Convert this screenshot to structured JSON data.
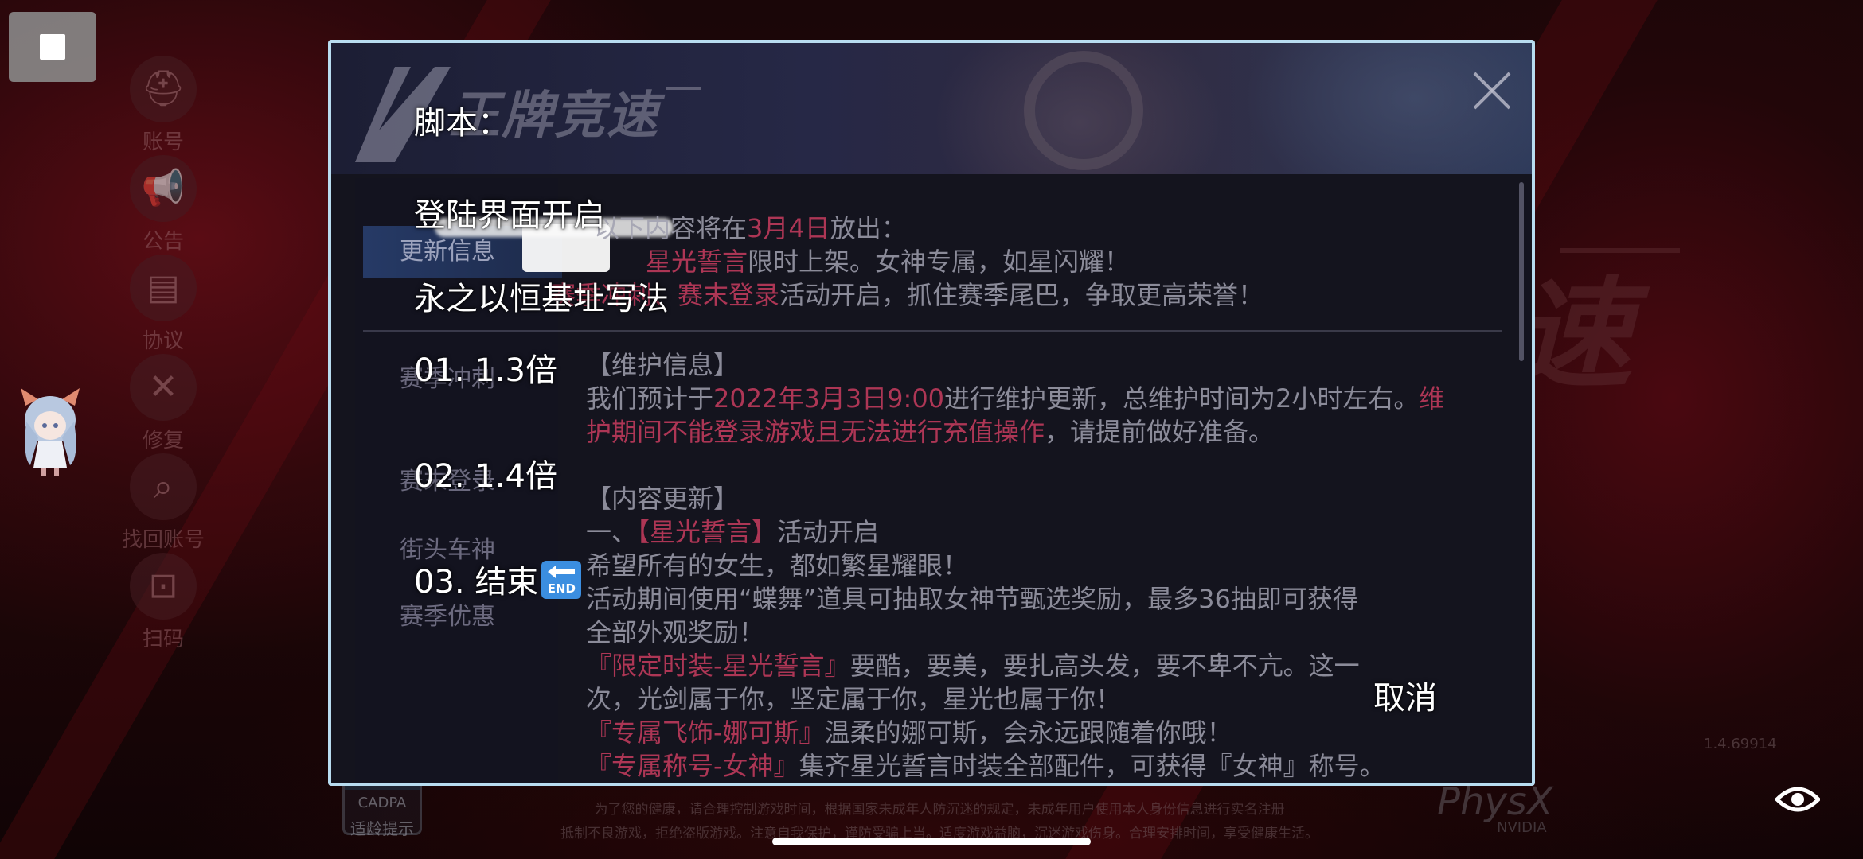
{
  "background": {
    "side_menu": [
      {
        "icon": "user-helmet-icon",
        "label": "账号"
      },
      {
        "icon": "megaphone-icon",
        "label": "公告"
      },
      {
        "icon": "document-icon",
        "label": "协议"
      },
      {
        "icon": "wrench-icon",
        "label": "修复"
      },
      {
        "icon": "magnifier-icon",
        "label": "找回账号"
      },
      {
        "icon": "qr-scan-icon",
        "label": "扫码"
      }
    ],
    "big_title": "速",
    "cadpa_label": "CADPA",
    "cadpa_sub": "适龄提示",
    "footer_lines": [
      "为了您的健康，请合理控制游戏时间，根据国家未成年人防沉迷的规定，未成年用户使用本人身份信息进行实名注册",
      "抵制不良游戏，拒绝盗版游戏。注意自我保护，谨防受骗上当。适度游戏益脑，沉迷游戏伤身。合理安排时间，享受健康生活。"
    ],
    "physx": "PhysX",
    "nvidia": "NVIDIA",
    "version": "1.4.69914"
  },
  "dialog": {
    "logo_text": "王牌竞速",
    "tabs": [
      {
        "label": "更新信息"
      },
      {
        "label": "赛季冲刺"
      },
      {
        "label": "赛末登录"
      },
      {
        "label": "街头车神"
      },
      {
        "label": "赛季优惠"
      }
    ],
    "top_lines": [
      {
        "pre": "以下内容将在",
        "hl": "3月4日",
        "post": "放出："
      },
      {
        "pre": "",
        "hl": "星光誓言",
        "post": "限时上架。女神专属，如星闪耀！"
      },
      {
        "pre": "",
        "hl": "赛季冲刺、赛末登录",
        "post": "活动开启，抓住赛季尾巴，争取更高荣誉！"
      }
    ],
    "maintenance_title": "【维护信息】",
    "maintenance_line1": {
      "pre": "我们预计于",
      "hl": "2022年3月3日9:00",
      "mid": "进行维护更新，总维护时间为2小时左右。",
      "hl2": "维"
    },
    "maintenance_line2": {
      "hl": "护期间不能登录游戏且无法进行充值操作",
      "post": "，请提前做好准备。"
    },
    "content_title": "【内容更新】",
    "content_item1": {
      "pre": "一、",
      "hl": "【星光誓言】",
      "post": "活动开启"
    },
    "content_lines": [
      "希望所有的女生，都如繁星耀眼！",
      "活动期间使用“蝶舞”道具可抽取女神节甄选奖励，最多36抽即可获得",
      "全部外观奖励！"
    ],
    "reward1": {
      "hl": "『限定时装-星光誓言』",
      "post": "要酷，要美，要扎高头发，要不卑不亢。这一"
    },
    "reward1_cont": "次，光剑属于你，坚定属于你，星光也属于你！",
    "reward2": {
      "hl": "『专属飞饰-娜可斯』",
      "post": "温柔的娜可斯，会永远跟随着你哦！"
    },
    "reward3": {
      "hl": "『专属称号-女神』",
      "post": "集齐星光誓言时装全部配件，可获得『女神』称号。"
    }
  },
  "script_popup": {
    "title": "脚本：",
    "option_login": "登陆界面开启",
    "option_address": "永之以恒基址写法",
    "option_1": "01.  1.3倍",
    "option_2": "02.  1.4倍",
    "option_3": "03.  结束",
    "end_emoji_text": "END",
    "cancel": "取消"
  },
  "overlay": {
    "stop_icon": "stop-square-icon",
    "eye_icon": "eye-icon"
  }
}
